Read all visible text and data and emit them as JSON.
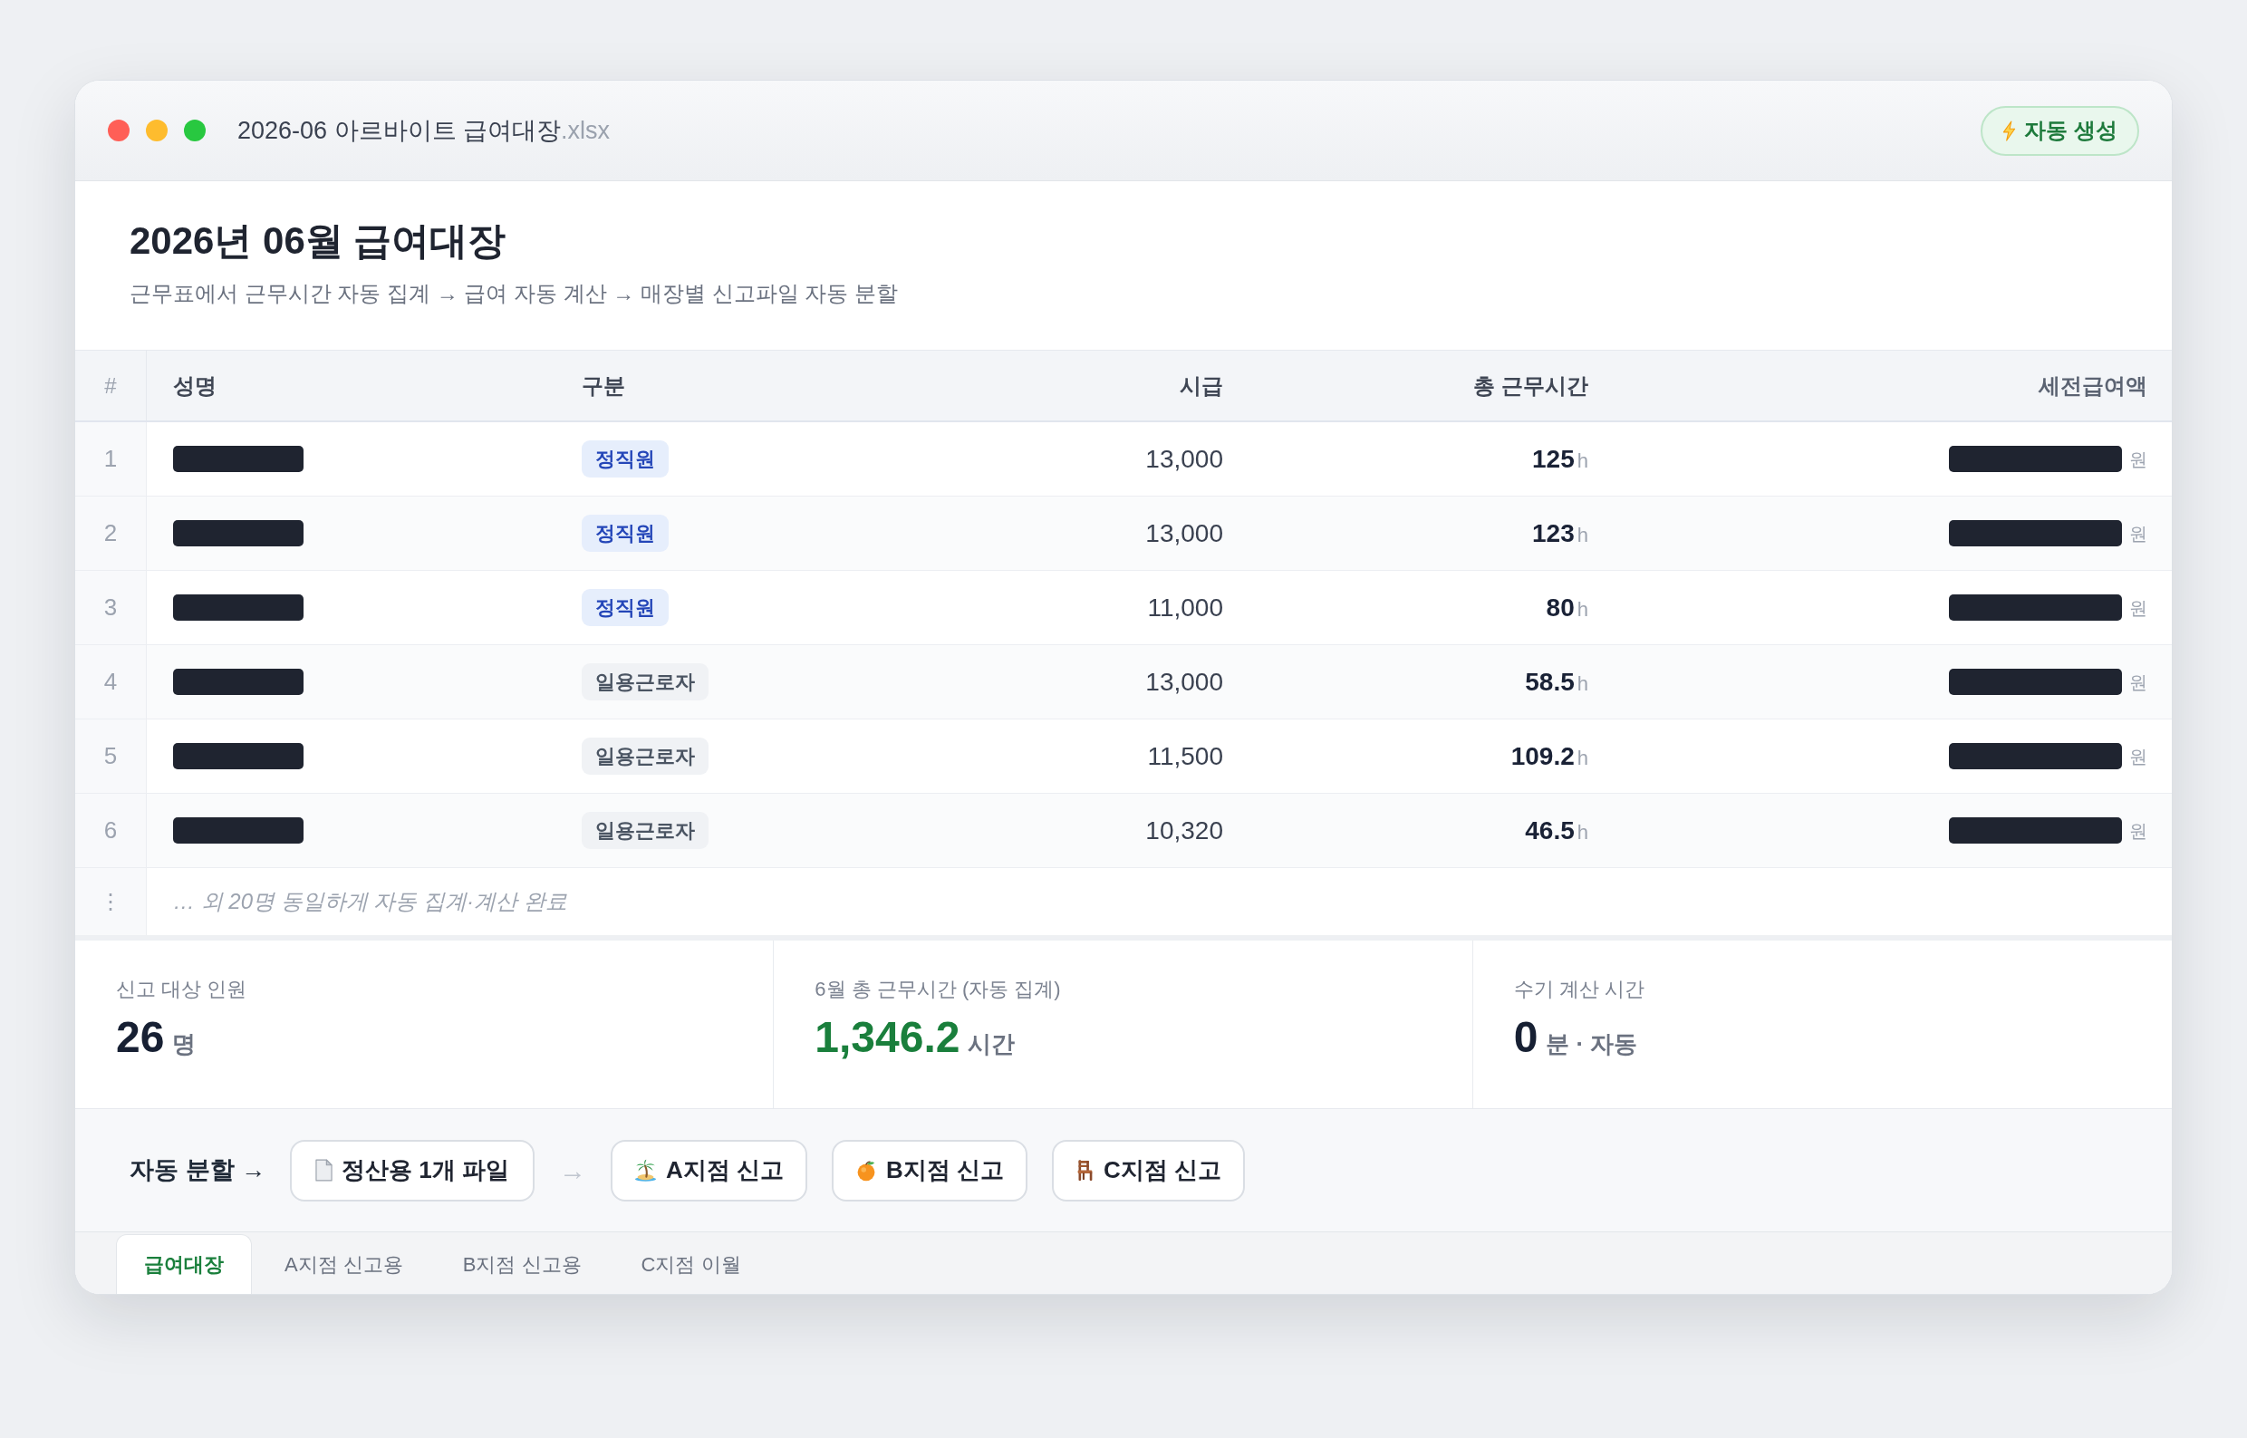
{
  "window": {
    "title": "2026-06 아르바이트 급여대장",
    "file_extension": ".xlsx",
    "action_button": {
      "label": "자동 생성"
    }
  },
  "header": {
    "title": "2026년 06월 급여대장",
    "subtitle": "근무표에서 근무시간 자동 집계 → 급여 자동 계산 → 매장별 신고파일 자동 분할"
  },
  "table": {
    "columns": [
      "#",
      "성명",
      "구분",
      "시급",
      "총 근무시간",
      "세전급여액"
    ],
    "rows": [
      {
        "number": "1",
        "name_redacted": true,
        "category": {
          "label": "정직원",
          "kind": "regular"
        },
        "hourly_wage": "13,000",
        "hours": "125",
        "hours_unit": "h",
        "pay_redacted": true,
        "pay_unit": "원"
      },
      {
        "number": "2",
        "name_redacted": true,
        "category": {
          "label": "정직원",
          "kind": "regular"
        },
        "hourly_wage": "13,000",
        "hours": "123",
        "hours_unit": "h",
        "pay_redacted": true,
        "pay_unit": "원"
      },
      {
        "number": "3",
        "name_redacted": true,
        "category": {
          "label": "정직원",
          "kind": "regular"
        },
        "hourly_wage": "11,000",
        "hours": "80",
        "hours_unit": "h",
        "pay_redacted": true,
        "pay_unit": "원"
      },
      {
        "number": "4",
        "name_redacted": true,
        "category": {
          "label": "일용근로자",
          "kind": "daily"
        },
        "hourly_wage": "13,000",
        "hours": "58.5",
        "hours_unit": "h",
        "pay_redacted": true,
        "pay_unit": "원"
      },
      {
        "number": "5",
        "name_redacted": true,
        "category": {
          "label": "일용근로자",
          "kind": "daily"
        },
        "hourly_wage": "11,500",
        "hours": "109.2",
        "hours_unit": "h",
        "pay_redacted": true,
        "pay_unit": "원"
      },
      {
        "number": "6",
        "name_redacted": true,
        "category": {
          "label": "일용근로자",
          "kind": "daily"
        },
        "hourly_wage": "10,320",
        "hours": "46.5",
        "hours_unit": "h",
        "pay_redacted": true,
        "pay_unit": "원"
      }
    ],
    "footer": {
      "marker": "⋮",
      "note": "… 외 20명 동일하게 자동 집계·계산 완료"
    }
  },
  "summary": [
    {
      "label": "신고 대상 인원",
      "value": "26",
      "unit": "명",
      "kind": "plain"
    },
    {
      "label": "6월 총 근무시간 (자동 집계)",
      "value": "1,346.2",
      "unit": "시간",
      "kind": "accent"
    },
    {
      "label": "수기 계산 시간",
      "value": "0",
      "unit": "분 · 자동",
      "kind": "plain"
    }
  ],
  "split_bar": {
    "label": "자동 분할 →",
    "source_button": "정산용 1개 파일",
    "arrow": "→",
    "target_buttons": [
      "A지점 신고",
      "B지점 신고",
      "C지점 신고"
    ]
  },
  "tabs": [
    {
      "label": "급여대장",
      "selected": true
    },
    {
      "label": "A지점 신고용",
      "selected": false
    },
    {
      "label": "B지점 신고용",
      "selected": false
    },
    {
      "label": "C지점 이월",
      "selected": false
    }
  ]
}
